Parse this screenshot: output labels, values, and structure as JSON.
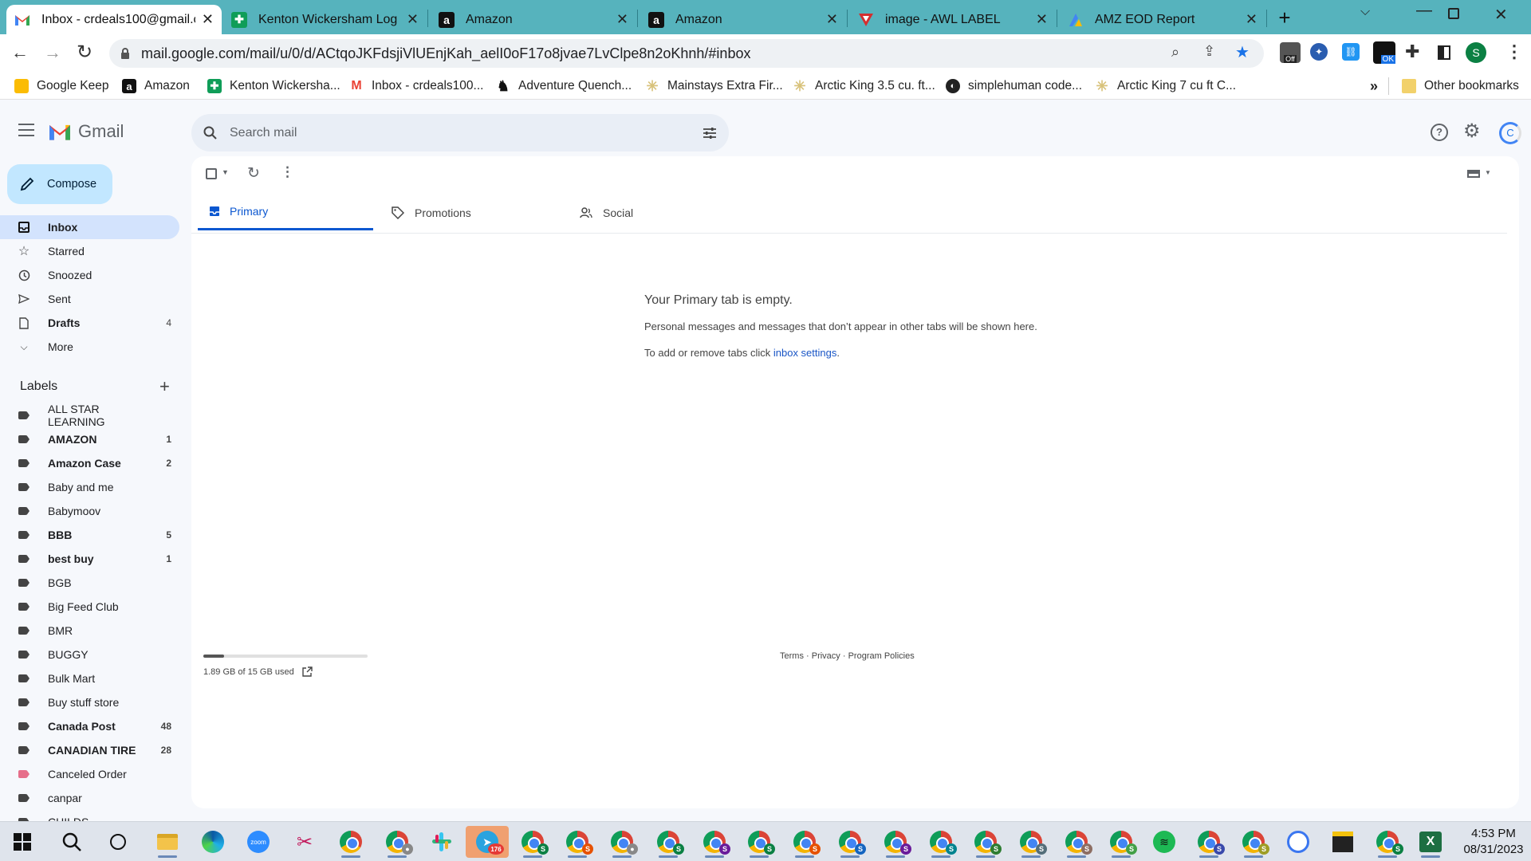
{
  "browser": {
    "tabs": [
      {
        "title": "Inbox - crdeals100@gmail.c",
        "favicon": "gmail-icon",
        "active": true
      },
      {
        "title": "Kenton Wickersham Log in",
        "favicon": "sheets-icon",
        "active": false
      },
      {
        "title": "Amazon",
        "favicon": "amazon-icon",
        "active": false
      },
      {
        "title": "Amazon",
        "favicon": "amazon-icon",
        "active": false
      },
      {
        "title": "image - AWL LABEL",
        "favicon": "awl-icon",
        "active": false
      },
      {
        "title": "AMZ EOD Report",
        "favicon": "report-icon",
        "active": false
      }
    ],
    "url": "mail.google.com/mail/u/0/d/ACtqoJKFdsjiVlUEnjKah_aelI0oF17o8jvae7LvClpe8n2oKhnh/#inbox",
    "profile_initial": "S",
    "extension_badge_off": "Off",
    "extension_badge_ok": "OK",
    "bookmarks": [
      "Google Keep",
      "Amazon",
      "Kenton Wickersha...",
      "Inbox - crdeals100...",
      "Adventure Quench...",
      "Mainstays Extra Fir...",
      "Arctic King 3.5 cu. ft...",
      "simplehuman code...",
      "Arctic King 7 cu ft C..."
    ],
    "overflow_label": "»",
    "other_bookmarks": "Other bookmarks"
  },
  "gmail": {
    "brand": "Gmail",
    "search_placeholder": "Search mail",
    "account_initial": "C",
    "compose": "Compose",
    "nav": [
      {
        "label": "Inbox",
        "count": "",
        "icon": "inbox-icon",
        "selected": true,
        "bold": true
      },
      {
        "label": "Starred",
        "count": "",
        "icon": "star-icon",
        "selected": false,
        "bold": false
      },
      {
        "label": "Snoozed",
        "count": "",
        "icon": "clock-icon",
        "selected": false,
        "bold": false
      },
      {
        "label": "Sent",
        "count": "",
        "icon": "send-icon",
        "selected": false,
        "bold": false
      },
      {
        "label": "Drafts",
        "count": "4",
        "icon": "draft-icon",
        "selected": false,
        "bold": true
      },
      {
        "label": "More",
        "count": "",
        "icon": "chevron-down-icon",
        "selected": false,
        "bold": false
      }
    ],
    "labels_heading": "Labels",
    "labels": [
      {
        "name": "ALL STAR LEARNING",
        "count": "",
        "bold": false,
        "color": "#444444"
      },
      {
        "name": "AMAZON",
        "count": "1",
        "bold": true,
        "color": "#444444"
      },
      {
        "name": "Amazon Case",
        "count": "2",
        "bold": true,
        "color": "#444444"
      },
      {
        "name": "Baby and me",
        "count": "",
        "bold": false,
        "color": "#444444"
      },
      {
        "name": "Babymoov",
        "count": "",
        "bold": false,
        "color": "#444444"
      },
      {
        "name": "BBB",
        "count": "5",
        "bold": true,
        "color": "#444444"
      },
      {
        "name": "best buy",
        "count": "1",
        "bold": true,
        "color": "#444444"
      },
      {
        "name": "BGB",
        "count": "",
        "bold": false,
        "color": "#444444"
      },
      {
        "name": "Big Feed Club",
        "count": "",
        "bold": false,
        "color": "#444444"
      },
      {
        "name": "BMR",
        "count": "",
        "bold": false,
        "color": "#444444"
      },
      {
        "name": "BUGGY",
        "count": "",
        "bold": false,
        "color": "#444444"
      },
      {
        "name": "Bulk Mart",
        "count": "",
        "bold": false,
        "color": "#444444"
      },
      {
        "name": "Buy stuff store",
        "count": "",
        "bold": false,
        "color": "#444444"
      },
      {
        "name": "Canada Post",
        "count": "48",
        "bold": true,
        "color": "#444444"
      },
      {
        "name": "CANADIAN TIRE",
        "count": "28",
        "bold": true,
        "color": "#444444"
      },
      {
        "name": "Canceled Order",
        "count": "",
        "bold": false,
        "color": "#e66e8a"
      },
      {
        "name": "canpar",
        "count": "",
        "bold": false,
        "color": "#444444"
      },
      {
        "name": "CHILDS",
        "count": "",
        "bold": false,
        "color": "#444444"
      }
    ],
    "category_tabs": [
      {
        "label": "Primary",
        "icon": "inbox-icon",
        "active": true
      },
      {
        "label": "Promotions",
        "icon": "tag-icon",
        "active": false
      },
      {
        "label": "Social",
        "icon": "people-icon",
        "active": false
      }
    ],
    "empty_state": {
      "title": "Your Primary tab is empty.",
      "line1": "Personal messages and messages that don’t appear in other tabs will be shown here.",
      "line2_prefix": "To add or remove tabs click ",
      "line2_link": "inbox settings",
      "line2_suffix": "."
    },
    "storage": {
      "text": "1.89 GB of 15 GB used",
      "fraction": 0.126
    },
    "footer": {
      "terms": "Terms",
      "dot1": " · ",
      "privacy": "Privacy",
      "dot2": " · ",
      "policies": "Program Policies"
    }
  },
  "taskbar": {
    "time": "4:53 PM",
    "date": "08/31/2023",
    "telegram_badge": "176",
    "accent": "#4a7bd0"
  }
}
